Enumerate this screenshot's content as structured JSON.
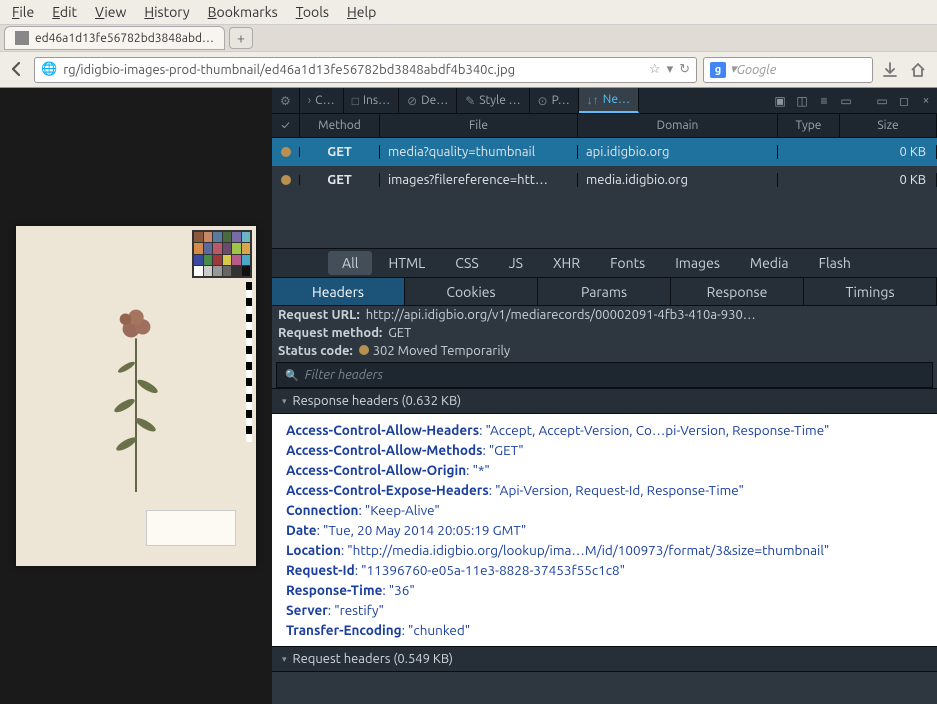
{
  "menu": [
    "File",
    "Edit",
    "View",
    "History",
    "Bookmarks",
    "Tools",
    "Help"
  ],
  "tab_title": "ed46a1d13fe56782bd3848abd…",
  "url": "rg/idigbio-images-prod-thumbnail/ed46a1d13fe56782bd3848abdf4b340c.jpg",
  "search_placeholder": "Google",
  "devtools_tabs": [
    {
      "icon": "⚙",
      "label": ""
    },
    {
      "icon": "›",
      "label": "C…"
    },
    {
      "icon": "□",
      "label": "Ins…"
    },
    {
      "icon": "⊘",
      "label": "De…"
    },
    {
      "icon": "✎",
      "label": "Style …"
    },
    {
      "icon": "⊙",
      "label": "P…"
    },
    {
      "icon": "↓↑",
      "label": "Ne…",
      "active": true
    }
  ],
  "net_columns": [
    "✓",
    "Method",
    "File",
    "Domain",
    "Type",
    "Size"
  ],
  "net_rows": [
    {
      "method": "GET",
      "file": "media?quality=thumbnail",
      "domain": "api.idigbio.org",
      "type": "",
      "size": "0 KB",
      "selected": true
    },
    {
      "method": "GET",
      "file": "images?filereference=htt…",
      "domain": "media.idigbio.org",
      "type": "",
      "size": "0 KB",
      "selected": false
    }
  ],
  "filter_tabs": [
    "All",
    "HTML",
    "CSS",
    "JS",
    "XHR",
    "Fonts",
    "Images",
    "Media",
    "Flash"
  ],
  "filter_active": "All",
  "subtabs": [
    "Headers",
    "Cookies",
    "Params",
    "Response",
    "Timings"
  ],
  "subtab_active": "Headers",
  "request_url_label": "Request URL:",
  "request_url": "http://api.idigbio.org/v1/mediarecords/00002091-4fb3-410a-930…",
  "request_method_label": "Request method:",
  "request_method": "GET",
  "status_code_label": "Status code:",
  "status_code": "302 Moved Temporarily",
  "filter_headers_placeholder": "Filter headers",
  "response_headers_title": "Response headers (0.632 KB)",
  "response_headers": [
    {
      "k": "Access-Control-Allow-Headers",
      "v": "\"Accept, Accept-Version, Co…pi-Version, Response-Time\""
    },
    {
      "k": "Access-Control-Allow-Methods",
      "v": "\"GET\""
    },
    {
      "k": "Access-Control-Allow-Origin",
      "v": "\"*\""
    },
    {
      "k": "Access-Control-Expose-Headers",
      "v": "\"Api-Version, Request-Id, Response-Time\""
    },
    {
      "k": "Connection",
      "v": "\"Keep-Alive\""
    },
    {
      "k": "Date",
      "v": "\"Tue, 20 May 2014 20:05:19 GMT\""
    },
    {
      "k": "Location",
      "v": "\"http://media.idigbio.org/lookup/ima…M/id/100973/format/3&size=thumbnail\""
    },
    {
      "k": "Request-Id",
      "v": "\"11396760-e05a-11e3-8828-37453f55c1c8\""
    },
    {
      "k": "Response-Time",
      "v": "\"36\""
    },
    {
      "k": "Server",
      "v": "\"restify\""
    },
    {
      "k": "Transfer-Encoding",
      "v": "\"chunked\""
    }
  ],
  "request_headers_title": "Request headers (0.549 KB)",
  "colors": [
    "#8b5a3c",
    "#c9876a",
    "#5a7a9e",
    "#4a6b3e",
    "#7a6ba8",
    "#6ab4c4",
    "#d68a4a",
    "#5a6a9e",
    "#b85a6a",
    "#6a4a6e",
    "#9ec44a",
    "#d6a84a",
    "#3a4a9e",
    "#4a8a4a",
    "#9e3a3a",
    "#d6c84a",
    "#b85a8a",
    "#4aa8c4",
    "#fff",
    "#ccc",
    "#999",
    "#666",
    "#333",
    "#111"
  ]
}
